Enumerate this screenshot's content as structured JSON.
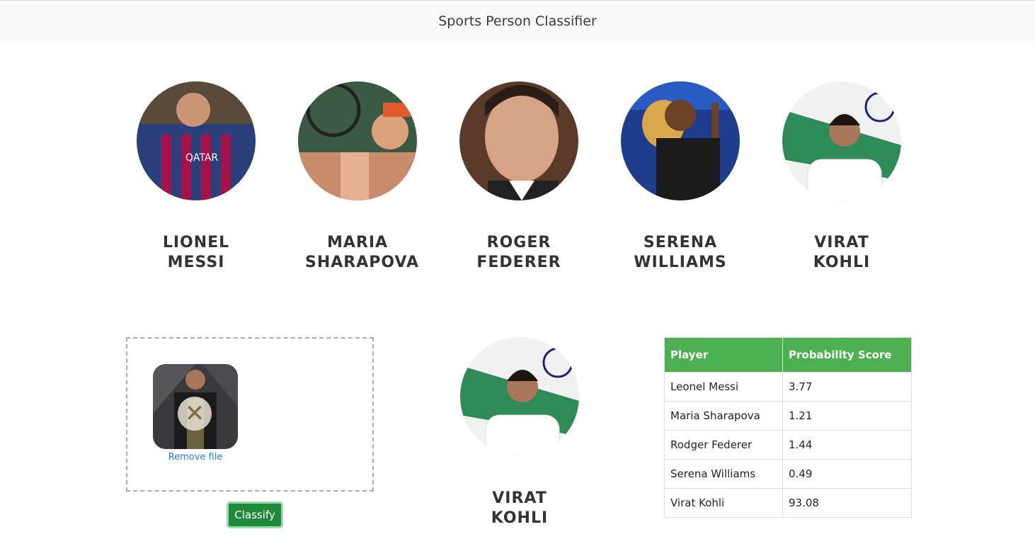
{
  "header": {
    "title": "Sports Person Classifier"
  },
  "players": [
    {
      "name": "LIONEL MESSI",
      "icon": "lionel-messi-photo"
    },
    {
      "name": "MARIA SHARAPOVA",
      "icon": "maria-sharapova-photo"
    },
    {
      "name": "ROGER FEDERER",
      "icon": "roger-federer-photo"
    },
    {
      "name": "SERENA WILLIAMS",
      "icon": "serena-williams-photo"
    },
    {
      "name": "VIRAT KOHLI",
      "icon": "virat-kohli-photo"
    }
  ],
  "upload": {
    "remove_label": "Remove file",
    "classify_label": "Classify"
  },
  "result": {
    "name": "VIRAT KOHLI"
  },
  "table": {
    "headers": [
      "Player",
      "Probability Score"
    ],
    "rows": [
      [
        "Leonel Messi",
        "3.77"
      ],
      [
        "Maria Sharapova",
        "1.21"
      ],
      [
        "Rodger Federer",
        "1.44"
      ],
      [
        "Serena Williams",
        "0.49"
      ],
      [
        "Virat Kohli",
        "93.08"
      ]
    ]
  },
  "colors": {
    "header_green": "#4caf50",
    "button_green": "#1e8a3a",
    "link_blue": "#1f7bd6"
  }
}
